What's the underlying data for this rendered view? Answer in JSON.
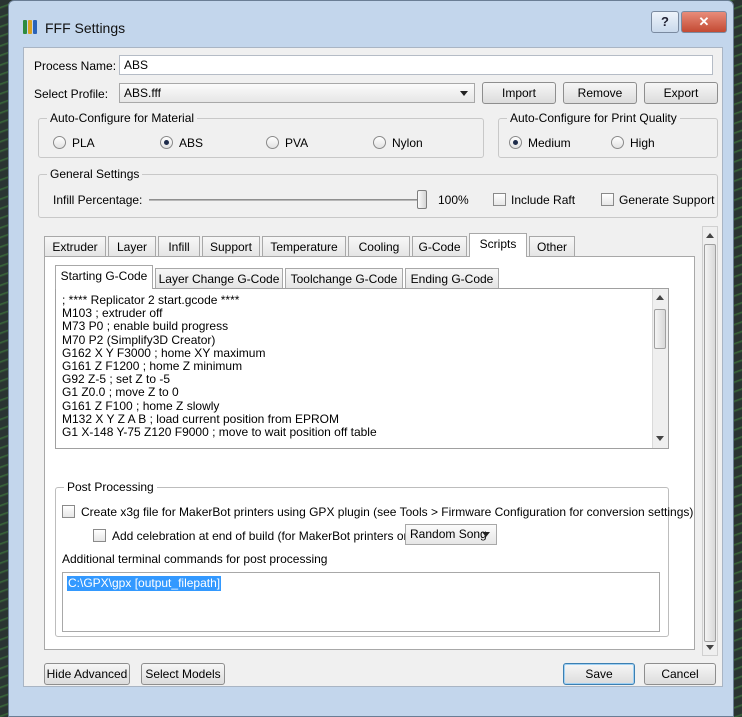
{
  "window": {
    "title": "FFF Settings",
    "help_label": "?",
    "close_label": "✕",
    "app_icon": "simplify3d-app-icon"
  },
  "process": {
    "label": "Process Name:",
    "value": "ABS"
  },
  "profile": {
    "label": "Select Profile:",
    "value": "ABS.fff",
    "import_label": "Import",
    "remove_label": "Remove",
    "export_label": "Export"
  },
  "material": {
    "title": "Auto-Configure for Material",
    "options": [
      {
        "label": "PLA",
        "selected": false
      },
      {
        "label": "ABS",
        "selected": true
      },
      {
        "label": "PVA",
        "selected": false
      },
      {
        "label": "Nylon",
        "selected": false
      }
    ]
  },
  "quality": {
    "title": "Auto-Configure for Print Quality",
    "options": [
      {
        "label": "Medium",
        "selected": true
      },
      {
        "label": "High",
        "selected": false
      }
    ]
  },
  "general": {
    "title": "General Settings",
    "infill_label": "Infill Percentage:",
    "infill_value": "100%",
    "infill_fraction": 1.0,
    "raft_label": "Include Raft",
    "raft_checked": false,
    "support_label": "Generate Support",
    "support_checked": false
  },
  "tabs": [
    "Extruder",
    "Layer",
    "Infill",
    "Support",
    "Temperature",
    "Cooling",
    "G-Code",
    "Scripts",
    "Other"
  ],
  "active_tab": "Scripts",
  "subtabs": [
    "Starting G-Code",
    "Layer Change G-Code",
    "Toolchange G-Code",
    "Ending G-Code"
  ],
  "active_subtab": "Starting G-Code",
  "gcode_lines": [
    "; **** Replicator 2 start.gcode ****",
    "M103 ; extruder off",
    "M73 P0 ; enable build progress",
    "M70 P2 (Simplify3D Creator)",
    "G162 X Y F3000 ; home XY maximum",
    "G161 Z F1200 ; home Z minimum",
    "G92 Z-5 ; set Z to -5",
    "G1 Z0.0 ; move Z to 0",
    "G161 Z F100 ; home Z slowly",
    "M132 X Y Z A B ; load current position from EPROM",
    "G1 X-148 Y-75 Z120 F9000 ; move to wait position off table"
  ],
  "post": {
    "title": "Post Processing",
    "x3g_label": "Create x3g file for MakerBot printers using GPX plugin (see Tools > Firmware Configuration for conversion settings)",
    "x3g_checked": false,
    "celebration_label": "Add celebration at end of build (for MakerBot printers only)",
    "celebration_checked": false,
    "song_value": "Random Song",
    "commands_label": "Additional terminal commands for post processing",
    "commands_value": "C:\\GPX\\gpx [output_filepath]"
  },
  "footer": {
    "hide_advanced_label": "Hide Advanced",
    "select_models_label": "Select Models",
    "save_label": "Save",
    "cancel_label": "Cancel"
  },
  "colors": {
    "accent": "#3399ff",
    "titlebar": "#c3d6ec",
    "close": "#c34a33"
  }
}
